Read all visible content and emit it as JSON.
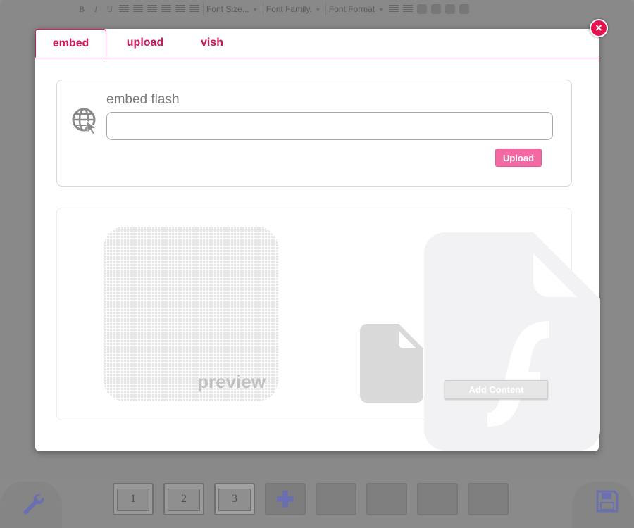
{
  "toolbar": {
    "bold": "B",
    "italic": "I",
    "underline": "U",
    "font_size": "Font Size...",
    "font_family": "Font Family.",
    "font_format": "Font Format"
  },
  "dialog": {
    "tabs": [
      {
        "label": "embed",
        "active": true
      },
      {
        "label": "upload",
        "active": false
      },
      {
        "label": "vish",
        "active": false
      }
    ],
    "close_label": "×",
    "embed": {
      "title": "embed flash",
      "input_value": "",
      "input_placeholder": "",
      "upload_label": "Upload"
    },
    "preview": {
      "label": "preview",
      "add_content_label": "Add Content"
    }
  },
  "slides": {
    "items": [
      {
        "number": "1"
      },
      {
        "number": "2"
      },
      {
        "number": "3",
        "selected": true
      }
    ]
  },
  "colors": {
    "accent": "#d4145a",
    "upload_button": "#f26aa1",
    "close_button": "#e8114f"
  },
  "icons": [
    "wrench-icon",
    "save-icon",
    "plus-icon",
    "globe-icon",
    "file-icon",
    "flash-file-icon",
    "close-icon"
  ]
}
